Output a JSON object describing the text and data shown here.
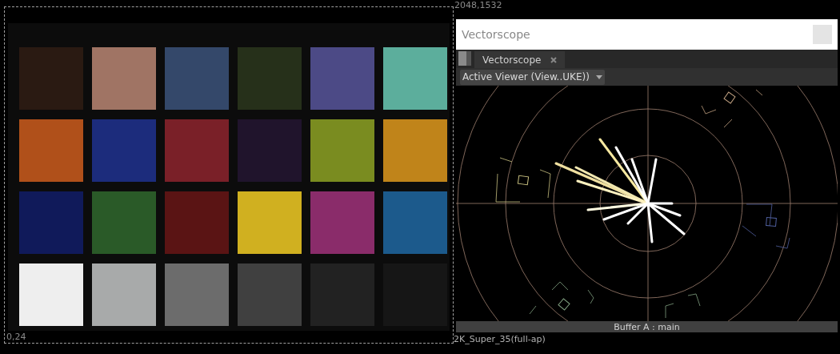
{
  "viewer": {
    "top_right_coord": "2048,1532",
    "bottom_left_coord": "0,24",
    "format": "2K_Super_35(full-ap)"
  },
  "panel": {
    "title": "Vectorscope",
    "tabs": [
      {
        "label": "Vectorscope",
        "selected": true
      }
    ],
    "source_dropdown": {
      "value": "Active Viewer (View..UKE))"
    },
    "buffer_label": "Buffer A : main"
  }
}
